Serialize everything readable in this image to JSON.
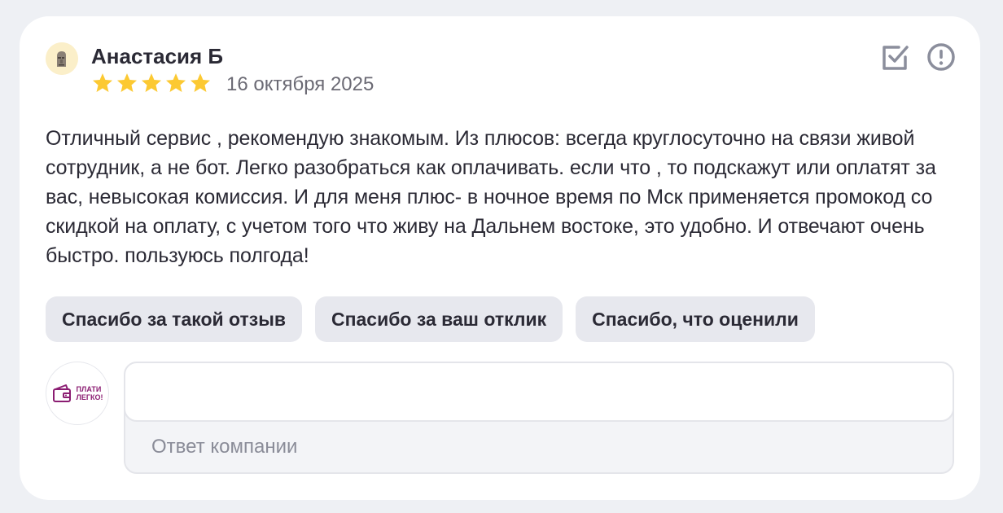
{
  "review": {
    "author": "Анастасия Б",
    "rating": 5,
    "rating_max": 5,
    "date": "16 октября 2025",
    "text": "Отличный сервис , рекомендую знакомым. Из плюсов: всегда круглосуточно на связи живой сотрудник, а не бот. Легко разобраться как оплачивать. если что , то подскажут или оплатят за вас, невысокая комиссия. И для меня плюс- в ночное время по Мск применяется промокод со скидкой на оплату, с учетом того что живу на Дальнем востоке, это удобно. И отвечают очень быстро. пользуюсь полгода!"
  },
  "actions": {
    "check_icon": "checkbox-check-icon",
    "report_icon": "exclamation-circle-icon"
  },
  "quick_replies": [
    "Спасибо за такой отзыв",
    "Спасибо за ваш отклик",
    "Спасибо, что оценили"
  ],
  "company": {
    "logo_text_line1": "ПЛАТИ",
    "logo_text_line2": "ЛЕГКО!",
    "logo_icon": "wallet-icon",
    "brand_color": "#8b1d72"
  },
  "reply": {
    "value": "",
    "label": "Ответ компании"
  },
  "colors": {
    "star": "#fcc932",
    "background": "#eef0f4",
    "chip_background": "#e7e8ee",
    "icon": "#8b8e9c"
  }
}
